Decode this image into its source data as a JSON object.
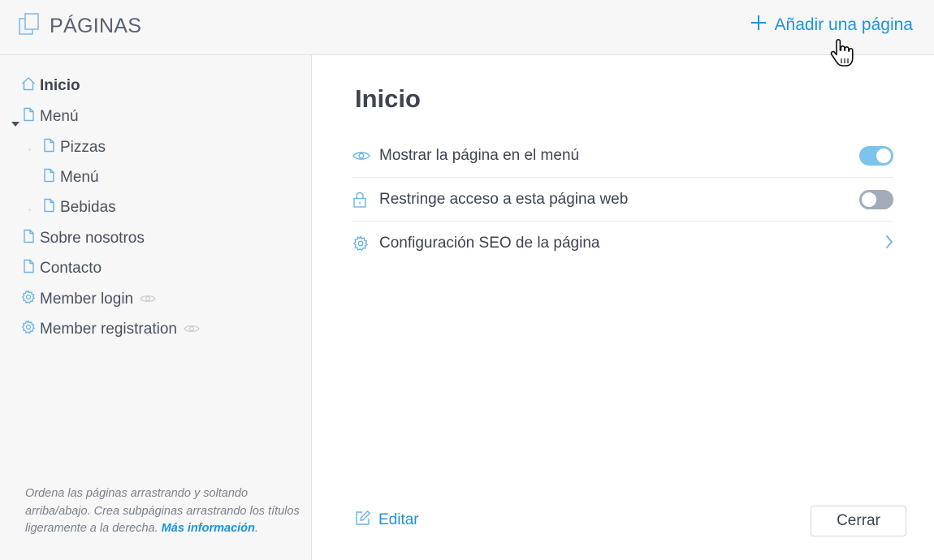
{
  "header": {
    "title": "PÁGINAS",
    "add_page_label": "Añadir una página"
  },
  "sidebar": {
    "items": [
      {
        "label": "Inicio",
        "icon": "home-icon",
        "active": true
      },
      {
        "label": "Menú",
        "icon": "page-icon",
        "expanded": true
      },
      {
        "label": "Pizzas",
        "icon": "page-icon",
        "level": 2
      },
      {
        "label": "Menú",
        "icon": "page-icon",
        "level": 2
      },
      {
        "label": "Bebidas",
        "icon": "page-icon",
        "level": 2
      },
      {
        "label": "Sobre nosotros",
        "icon": "page-icon"
      },
      {
        "label": "Contacto",
        "icon": "page-icon"
      },
      {
        "label": "Member login",
        "icon": "gear-icon",
        "hidden_badge": "eye-icon"
      },
      {
        "label": "Member registration",
        "icon": "gear-icon",
        "hidden_badge": "eye-icon"
      }
    ],
    "help_text": "Ordena las páginas arrastrando y soltando arriba/abajo. Crea subpáginas arrastrando los títulos ligeramente a la derecha.",
    "help_link": "Más información",
    "help_end": "."
  },
  "main": {
    "title": "Inicio",
    "settings": [
      {
        "label": "Mostrar la página en el menú",
        "icon": "eye-icon",
        "control": "toggle",
        "enabled": true
      },
      {
        "label": "Restringe acceso a esta página web",
        "icon": "lock-icon",
        "control": "toggle",
        "enabled": false
      },
      {
        "label": "Configuración SEO de la página",
        "icon": "gear-icon",
        "control": "chevron-right-icon"
      }
    ],
    "edit_label": "Editar",
    "close_label": "Cerrar"
  },
  "colors": {
    "accent": "#1f93dc",
    "toggle_on": "#7cc3ee",
    "toggle_off": "#a4aab8",
    "icon_blue": "#6ab4e6",
    "panel_bg": "#f7f7f7"
  }
}
